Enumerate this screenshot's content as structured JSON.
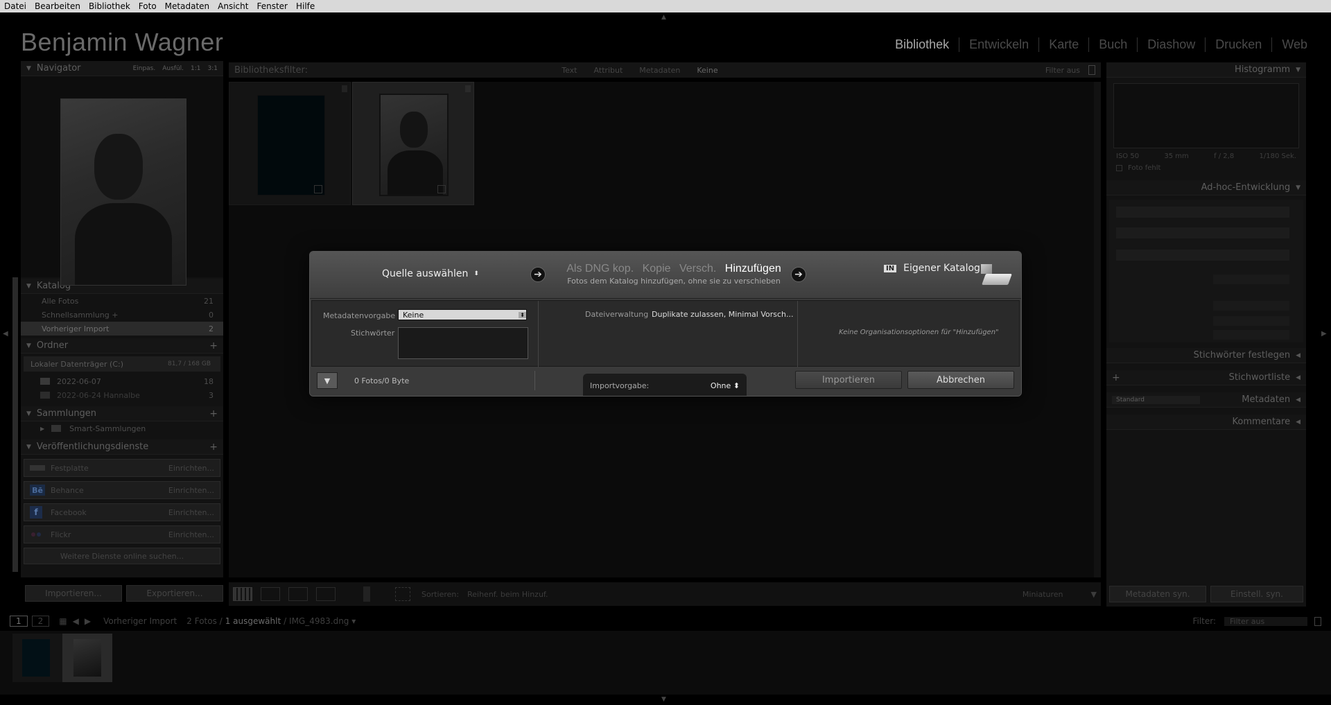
{
  "menu": [
    "Datei",
    "Bearbeiten",
    "Bibliothek",
    "Foto",
    "Metadaten",
    "Ansicht",
    "Fenster",
    "Hilfe"
  ],
  "identity_plate": "Benjamin Wagner",
  "modules": [
    {
      "label": "Bibliothek",
      "active": true
    },
    {
      "label": "Entwickeln",
      "active": false
    },
    {
      "label": "Karte",
      "active": false
    },
    {
      "label": "Buch",
      "active": false
    },
    {
      "label": "Diashow",
      "active": false
    },
    {
      "label": "Drucken",
      "active": false
    },
    {
      "label": "Web",
      "active": false
    }
  ],
  "navigator": {
    "title": "Navigator",
    "options": [
      "Einpas.",
      "Ausfül.",
      "1:1",
      "3:1"
    ]
  },
  "katalog": {
    "title": "Katalog",
    "items": [
      {
        "label": "Alle Fotos",
        "count": "21"
      },
      {
        "label": "Schnellsammlung +",
        "count": "0"
      },
      {
        "label": "Vorheriger Import",
        "count": "2"
      }
    ]
  },
  "ordner": {
    "title": "Ordner",
    "drive": "Lokaler Datenträger (C:)",
    "drive_space": "81,7 / 168 GB",
    "items": [
      {
        "label": "2022-06-07",
        "count": "18"
      },
      {
        "label": "2022-06-24 Hannalbe",
        "count": "3"
      }
    ]
  },
  "sammlungen": {
    "title": "Sammlungen",
    "items": [
      "Smart-Sammlungen"
    ]
  },
  "publish": {
    "title": "Veröffentlichungsdienste",
    "items": [
      {
        "label": "Festplatte",
        "action": "Einrichten..."
      },
      {
        "label": "Behance",
        "action": "Einrichten..."
      },
      {
        "label": "Facebook",
        "action": "Einrichten..."
      },
      {
        "label": "Flickr",
        "action": "Einrichten..."
      }
    ],
    "more": "Weitere Dienste online suchen..."
  },
  "left_buttons": {
    "import": "Importieren...",
    "export": "Exportieren..."
  },
  "filterbar": {
    "label": "Bibliotheksfilter:",
    "options": [
      "Text",
      "Attribut",
      "Metadaten",
      "Keine"
    ],
    "right": "Filter aus"
  },
  "toolbar": {
    "sort_label": "Sortieren:",
    "sort_value": "Reihenf. beim Hinzuf.",
    "thumbs": "Miniaturen"
  },
  "right": {
    "histogram": "Histogramm",
    "exif": [
      "ISO 50",
      "35 mm",
      "f / 2,8",
      "1/180 Sek."
    ],
    "foto_fehlt": "Foto fehlt",
    "adhoc": "Ad-hoc-Entwicklung",
    "stichwort_festlegen": "Stichwörter festlegen",
    "stichwortliste": "Stichwortliste",
    "metadaten": "Metadaten",
    "metadaten_preset": "Standard",
    "kommentare": "Kommentare",
    "btn_sync_meta": "Metadaten syn.",
    "btn_sync_settings": "Einstell. syn."
  },
  "filmstrip": {
    "pages": [
      "1",
      "2"
    ],
    "source": "Vorheriger Import",
    "count": "2 Fotos /",
    "selected": "1 ausgewählt",
    "filename": "/ IMG_4983.dng ▾",
    "filter_label": "Filter:",
    "filter_value": "Filter aus"
  },
  "dialog": {
    "source": "Quelle auswählen",
    "modes": [
      "Als DNG kop.",
      "Kopie",
      "Versch.",
      "Hinzufügen"
    ],
    "mode_desc": "Fotos dem Katalog hinzufügen, ohne sie zu verschieben",
    "in_badge": "IN",
    "catalog": "Eigener Katalog",
    "meta_label": "Metadatenvorgabe",
    "meta_value": "Keine",
    "keywords_label": "Stichwörter",
    "file_label": "Dateiverwaltung",
    "file_value": "Duplikate zulassen, Minimal Vorsch...",
    "org_note": "Keine Organisationsoptionen für \"Hinzufügen\"",
    "photo_count": "0 Fotos/0 Byte",
    "preset_label": "Importvorgabe:",
    "preset_value": "Ohne ⬍",
    "import": "Importieren",
    "cancel": "Abbrechen"
  }
}
